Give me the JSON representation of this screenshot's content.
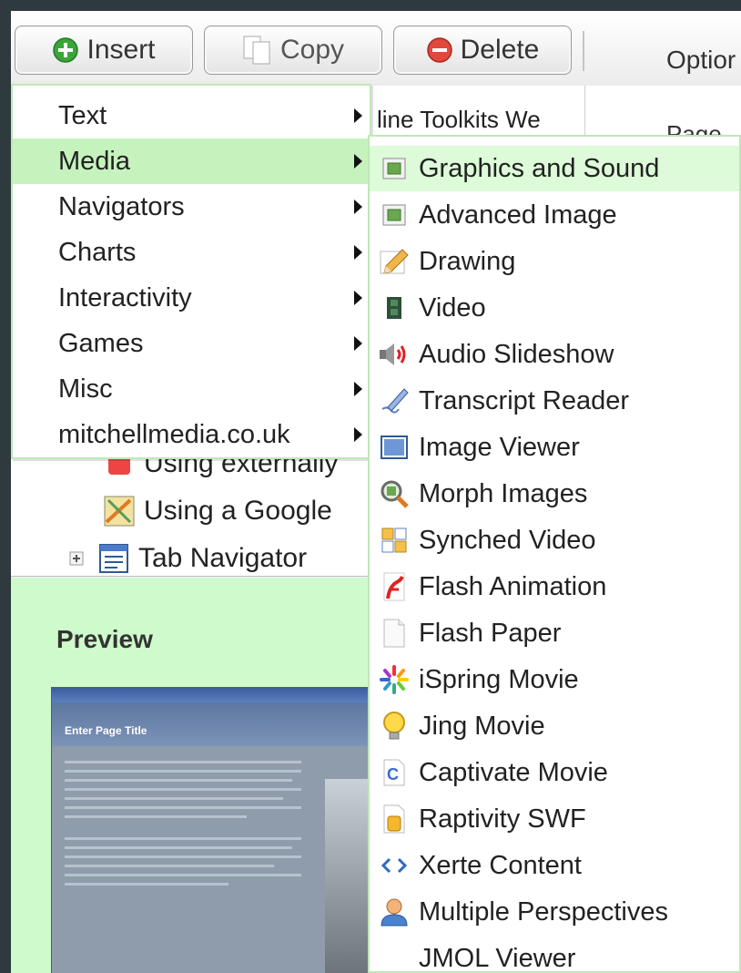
{
  "toolbar": {
    "insert_label": "Insert",
    "copy_label": "Copy",
    "delete_label": "Delete",
    "options_label": "Optior"
  },
  "background": {
    "tab_title": "line Toolkits We",
    "page_label": "Page",
    "tree_items": [
      {
        "label": "Using externally",
        "icon": "youtube-icon"
      },
      {
        "label": "Using a Google",
        "icon": "google-map-icon"
      },
      {
        "label": "Tab Navigator",
        "icon": "tab-navigator-icon"
      }
    ],
    "preview_label": "Preview",
    "thumb_title": "Enter Page Title"
  },
  "insert_menu": {
    "items": [
      {
        "label": "Text"
      },
      {
        "label": "Media"
      },
      {
        "label": "Navigators"
      },
      {
        "label": "Charts"
      },
      {
        "label": "Interactivity"
      },
      {
        "label": "Games"
      },
      {
        "label": "Misc"
      },
      {
        "label": "mitchellmedia.co.uk"
      }
    ],
    "selected": "Media"
  },
  "media_menu": {
    "items": [
      {
        "label": "Graphics and Sound",
        "icon": "graphics-icon"
      },
      {
        "label": "Advanced Image",
        "icon": "image-icon"
      },
      {
        "label": "Drawing",
        "icon": "pencil-icon"
      },
      {
        "label": "Video",
        "icon": "film-icon"
      },
      {
        "label": "Audio Slideshow",
        "icon": "speaker-icon"
      },
      {
        "label": "Transcript Reader",
        "icon": "pen-icon"
      },
      {
        "label": "Image Viewer",
        "icon": "window-icon"
      },
      {
        "label": "Morph Images",
        "icon": "magnifier-icon"
      },
      {
        "label": "Synched Video",
        "icon": "grid-icon"
      },
      {
        "label": "Flash Animation",
        "icon": "flash-icon"
      },
      {
        "label": "Flash Paper",
        "icon": "page-icon"
      },
      {
        "label": "iSpring Movie",
        "icon": "ispring-icon"
      },
      {
        "label": "Jing Movie",
        "icon": "bulb-icon"
      },
      {
        "label": "Captivate Movie",
        "icon": "captivate-icon"
      },
      {
        "label": "Raptivity SWF",
        "icon": "raptivity-icon"
      },
      {
        "label": "Xerte Content",
        "icon": "code-icon"
      },
      {
        "label": "Multiple Perspectives",
        "icon": "person-icon"
      },
      {
        "label": "JMOL Viewer",
        "icon": ""
      }
    ],
    "selected": "Graphics and Sound"
  }
}
